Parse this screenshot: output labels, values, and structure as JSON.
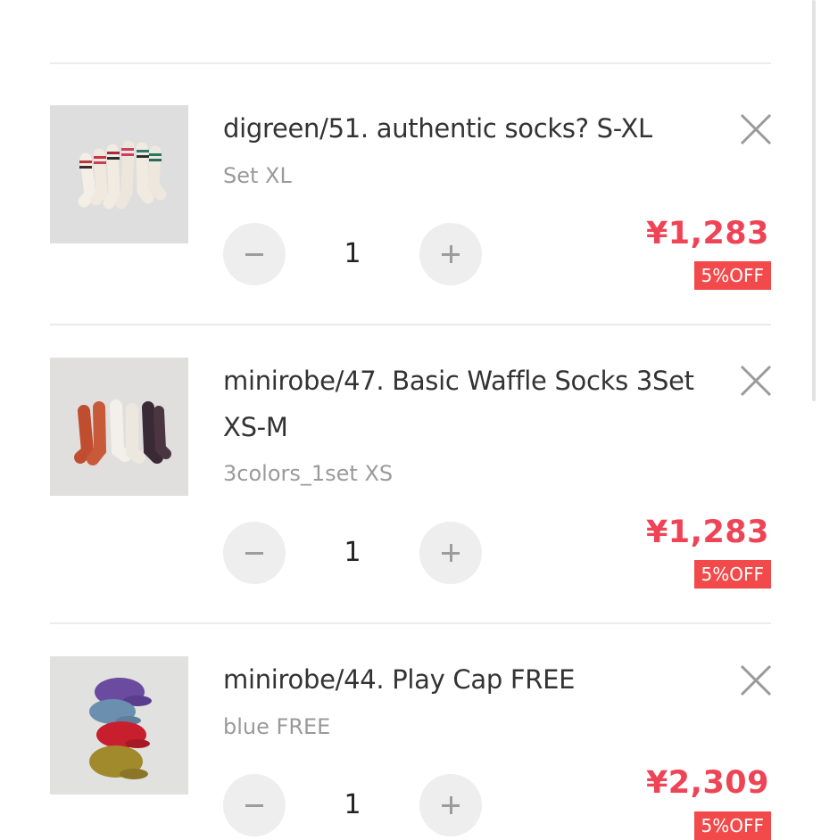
{
  "cart": {
    "items": [
      {
        "title": "digreen/51. authentic socks? S-XL",
        "option": "Set XL",
        "quantity": "1",
        "price": "¥1,283",
        "discount_badge": "5%OFF",
        "thumbnail": "striped-socks-photo"
      },
      {
        "title": "minirobe/47. Basic Waffle Socks 3Set XS-M",
        "option": "3colors_1set XS",
        "quantity": "1",
        "price": "¥1,283",
        "discount_badge": "5%OFF",
        "thumbnail": "waffle-socks-photo"
      },
      {
        "title": "minirobe/44. Play Cap FREE",
        "option": "blue FREE",
        "quantity": "1",
        "price": "¥2,309",
        "discount_badge": "5%OFF",
        "thumbnail": "stacked-caps-photo"
      }
    ]
  },
  "icons": {
    "remove": "close-icon",
    "decrease": "minus-icon",
    "increase": "plus-icon"
  },
  "colors": {
    "price": "#ee4455",
    "badge_bg": "#f24a4a",
    "qty_button_bg": "#eeeeee",
    "divider": "#ebebeb"
  }
}
